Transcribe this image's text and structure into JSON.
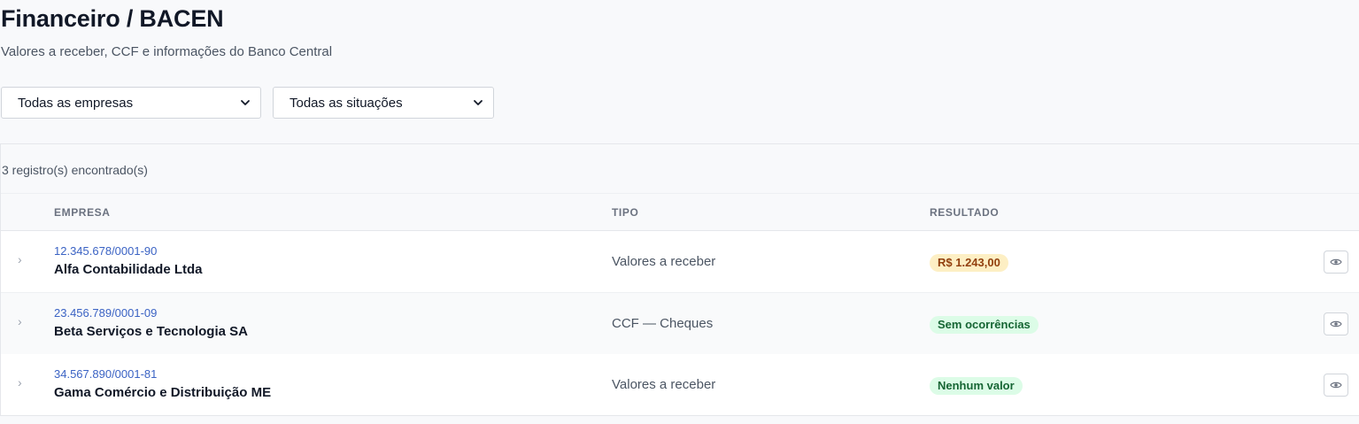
{
  "page": {
    "title": "Financeiro / BACEN",
    "subtitle": "Valores a receber, CCF e informações do Banco Central"
  },
  "filters": {
    "company": "Todas as empresas",
    "status": "Todas as situações"
  },
  "results": {
    "count_text": "3 registro(s) encontrado(s)"
  },
  "table": {
    "headers": {
      "empresa": "EMPRESA",
      "tipo": "TIPO",
      "resultado": "RESULTADO"
    },
    "rows": [
      {
        "cnpj": "12.345.678/0001-90",
        "empresa": "Alfa Contabilidade Ltda",
        "tipo": "Valores a receber",
        "resultado": "R$ 1.243,00",
        "badge_bg": "#fdefc4",
        "badge_fg": "#92400e"
      },
      {
        "cnpj": "23.456.789/0001-09",
        "empresa": "Beta Serviços e Tecnologia SA",
        "tipo": "CCF — Cheques",
        "resultado": "Sem ocorrências",
        "badge_bg": "#dcfce7",
        "badge_fg": "#166534"
      },
      {
        "cnpj": "34.567.890/0001-81",
        "empresa": "Gama Comércio e Distribuição ME",
        "tipo": "Valores a receber",
        "resultado": "Nenhum valor",
        "badge_bg": "#dcfce7",
        "badge_fg": "#166534"
      }
    ]
  },
  "icons": {
    "expand": "chevron-right-icon",
    "view": "eye-icon",
    "select": "chevron-down-icon"
  },
  "colors": {
    "link": "#3b63c4",
    "background": "#f8f9fb"
  }
}
